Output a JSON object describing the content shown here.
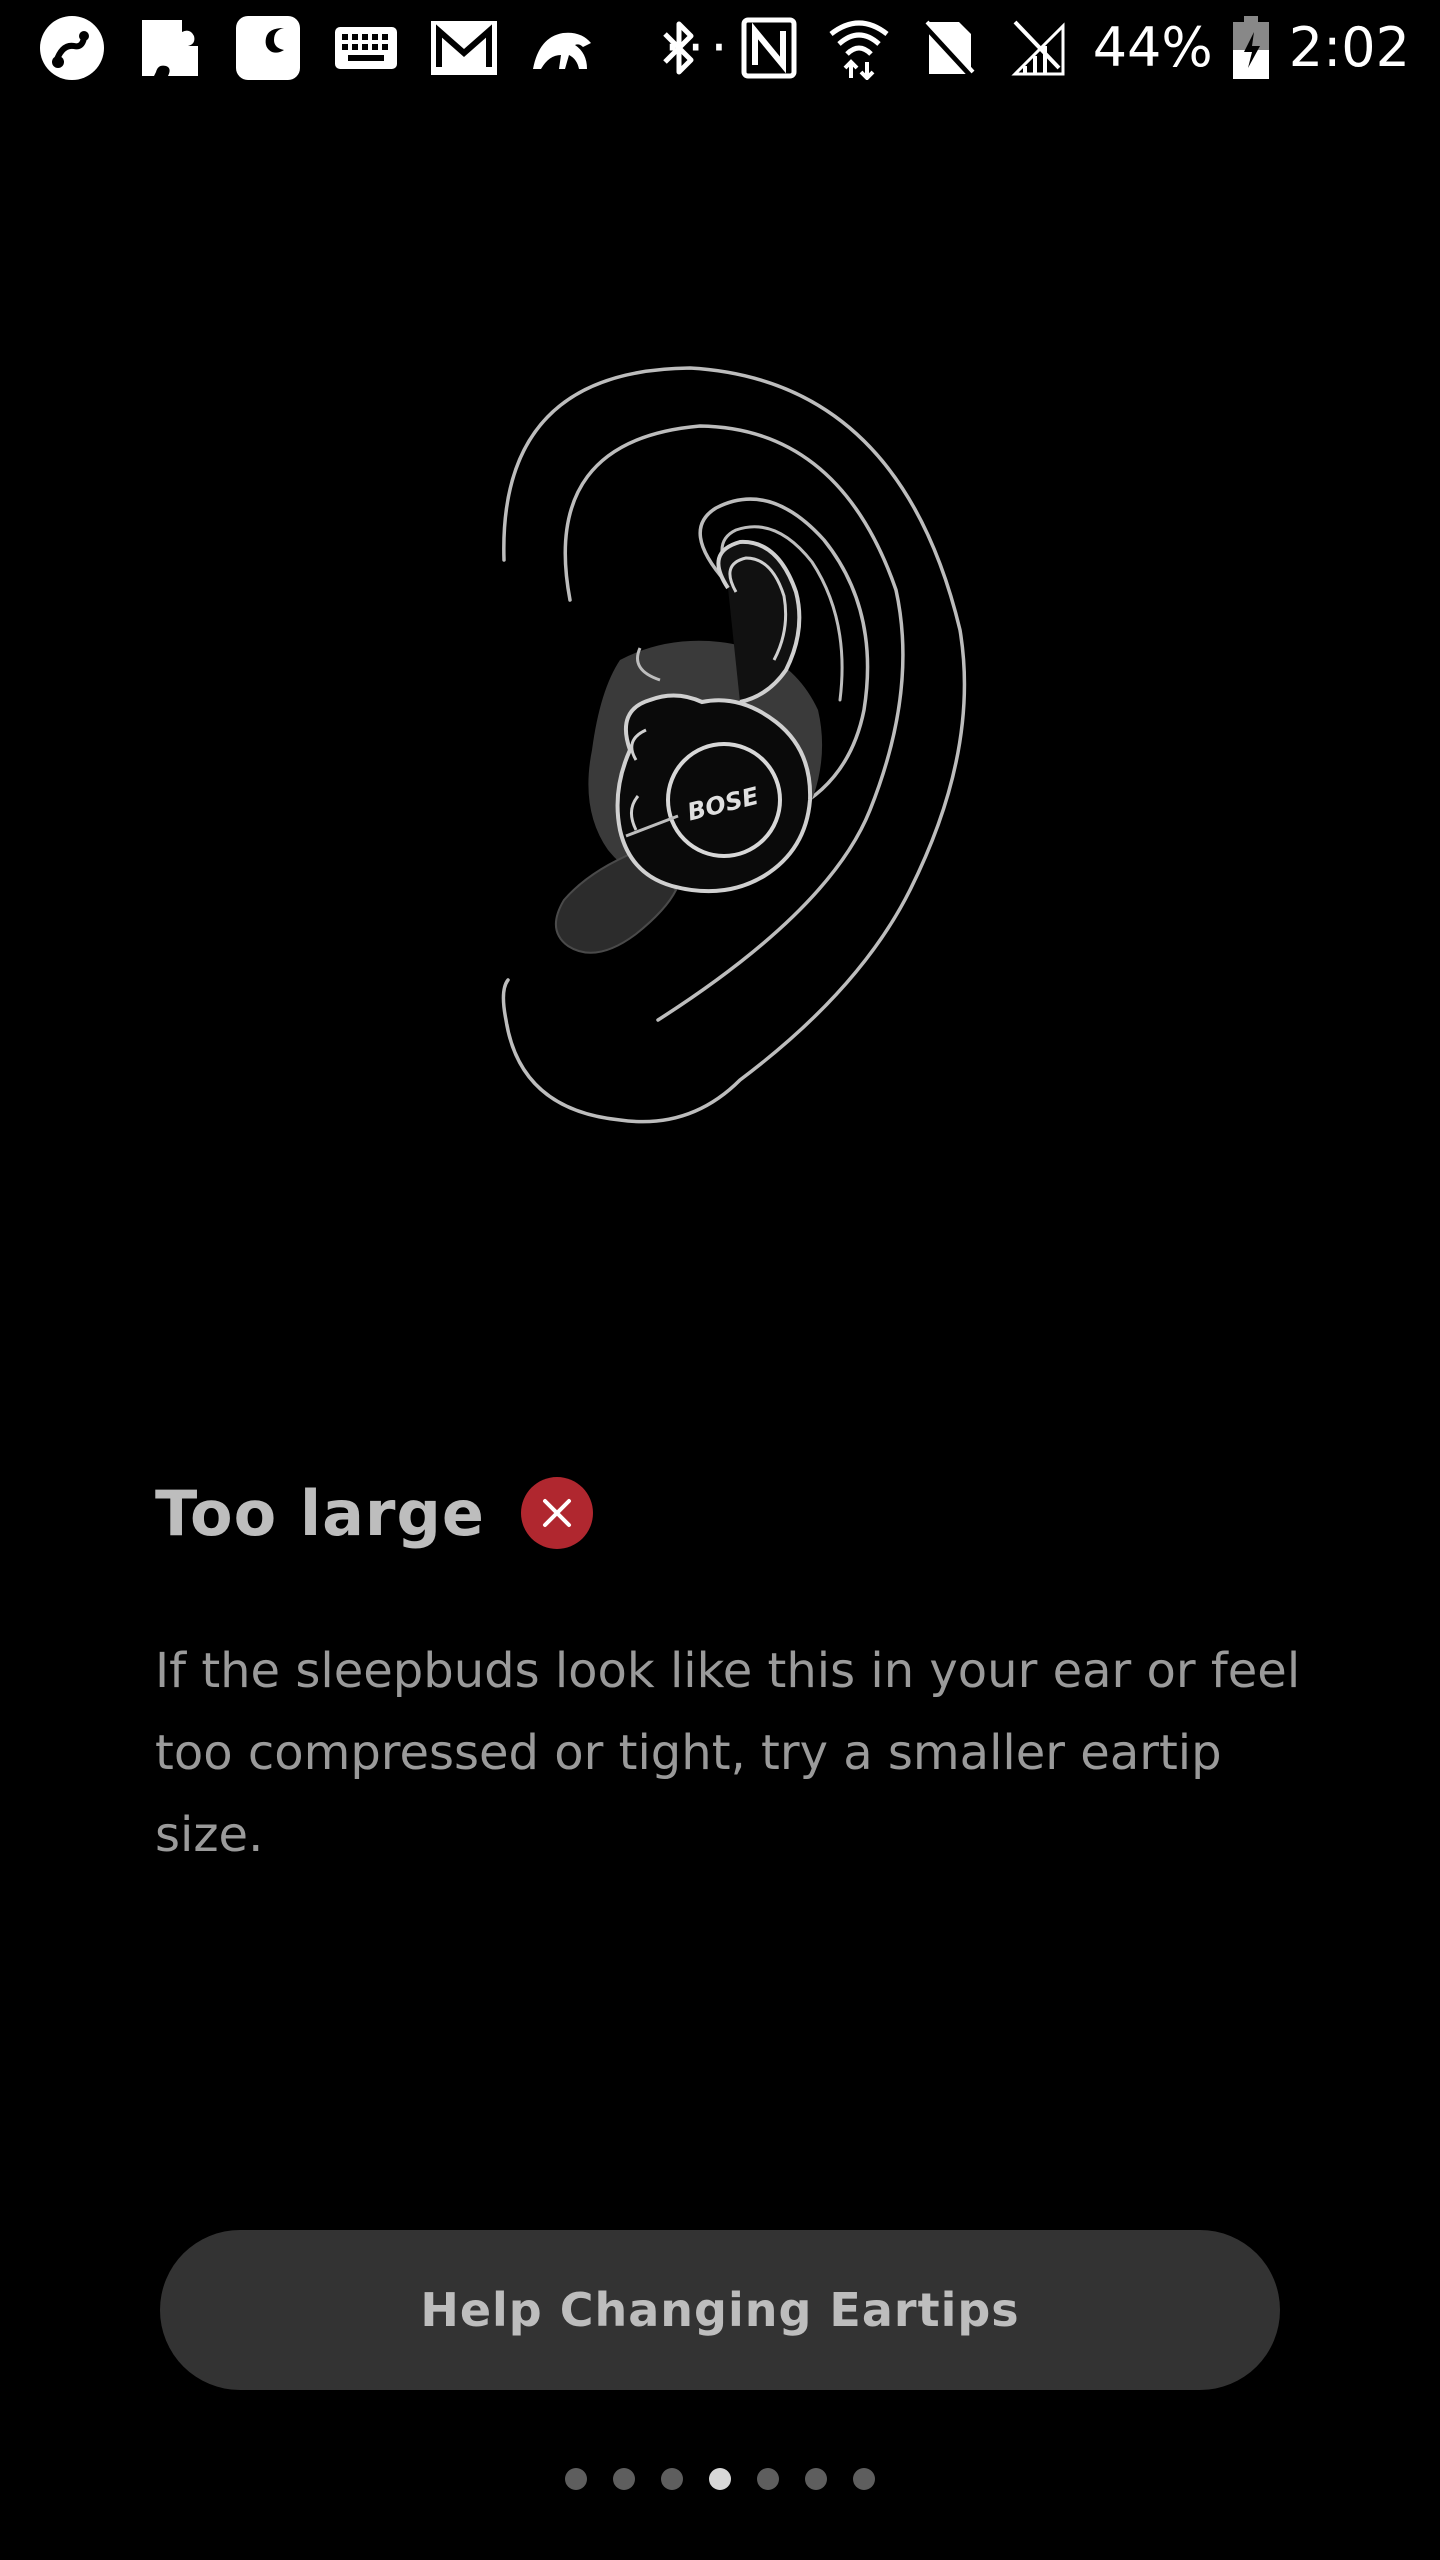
{
  "status_bar": {
    "left_icons": [
      "podcast-app-icon",
      "puzzle-icon",
      "moon-icon",
      "keyboard-icon",
      "gmail-icon",
      "bird-icon"
    ],
    "overflow": "···",
    "right_icons": [
      "bluetooth-icon",
      "nfc-icon",
      "wifi-icon",
      "no-sim-icon",
      "signal-icon"
    ],
    "battery_percent": "44%",
    "time": "2:02"
  },
  "screen": {
    "title": "Too large",
    "status_icon": "close-icon",
    "status_color": "#b0272f",
    "description": "If the sleepbuds look like this in your ear or feel too compressed or tight, try a smaller eartip size.",
    "illustration_brand": "BOSE"
  },
  "help_button": {
    "label": "Help Changing Eartips"
  },
  "pager": {
    "total": 7,
    "active_index": 3
  }
}
